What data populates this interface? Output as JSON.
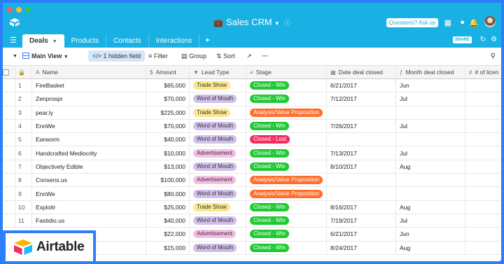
{
  "app": {
    "base_title": "Sales CRM",
    "help_button": "Questions? Ask us",
    "share_label": "SHARE"
  },
  "tabs": [
    {
      "label": "Deals",
      "active": true
    },
    {
      "label": "Products",
      "active": false
    },
    {
      "label": "Contacts",
      "active": false
    },
    {
      "label": "Interactions",
      "active": false
    }
  ],
  "toolbar": {
    "view_name": "Main View",
    "hidden_field": "1 hidden field",
    "filter": "Filter",
    "group": "Group",
    "sort": "Sort",
    "more": "···"
  },
  "columns": {
    "name": "Name",
    "amount": "Amount",
    "lead_type": "Lead Type",
    "stage": "Stage",
    "date_closed": "Date deal closed",
    "month_closed": "Month deal closed",
    "licenses": "# of licen"
  },
  "rows": [
    {
      "num": "1",
      "name": "FireBasket",
      "amount": "$65,000",
      "lead": "Trade Show",
      "lead_kind": "ts",
      "stage": "Closed - Win",
      "stage_kind": "win",
      "date": "6/21/2017",
      "month": "Jun"
    },
    {
      "num": "2",
      "name": "Zenprospr",
      "amount": "$70,000",
      "lead": "Word of Mouth",
      "lead_kind": "wom",
      "stage": "Closed - Win",
      "stage_kind": "win",
      "date": "7/12/2017",
      "month": "Jul"
    },
    {
      "num": "3",
      "name": "pear.ly",
      "amount": "$225,000",
      "lead": "Trade Show",
      "lead_kind": "ts",
      "stage": "Analysis/Value Proposition",
      "stage_kind": "avp",
      "date": "",
      "month": ""
    },
    {
      "num": "4",
      "name": "EnnWe",
      "amount": "$70,000",
      "lead": "Word of Mouth",
      "lead_kind": "wom",
      "stage": "Closed - Win",
      "stage_kind": "win",
      "date": "7/26/2017",
      "month": "Jul"
    },
    {
      "num": "5",
      "name": "Earworm",
      "amount": "$40,000",
      "lead": "Word of Mouth",
      "lead_kind": "wom",
      "stage": "Closed - Lost",
      "stage_kind": "lost",
      "date": "",
      "month": ""
    },
    {
      "num": "6",
      "name": "Handcrafted Mediocrity",
      "amount": "$10,000",
      "lead": "Advertisement",
      "lead_kind": "ad",
      "stage": "Closed - Win",
      "stage_kind": "win",
      "date": "7/13/2017",
      "month": "Jul"
    },
    {
      "num": "7",
      "name": "Objectively Edible",
      "amount": "$13,000",
      "lead": "Word of Mouth",
      "lead_kind": "wom",
      "stage": "Closed - Win",
      "stage_kind": "win",
      "date": "8/10/2017",
      "month": "Aug"
    },
    {
      "num": "8",
      "name": "Consens.us",
      "amount": "$100,000",
      "lead": "Advertisement",
      "lead_kind": "ad",
      "stage": "Analysis/Value Proposition",
      "stage_kind": "avp",
      "date": "",
      "month": ""
    },
    {
      "num": "9",
      "name": "EnnWe",
      "amount": "$80,000",
      "lead": "Word of Mouth",
      "lead_kind": "wom",
      "stage": "Analysis/Value Proposition",
      "stage_kind": "avp",
      "date": "",
      "month": ""
    },
    {
      "num": "10",
      "name": "Exploitr",
      "amount": "$25,000",
      "lead": "Trade Show",
      "lead_kind": "ts",
      "stage": "Closed - Win",
      "stage_kind": "win",
      "date": "8/16/2017",
      "month": "Aug"
    },
    {
      "num": "11",
      "name": "Fastidio.us",
      "amount": "$40,000",
      "lead": "Word of Mouth",
      "lead_kind": "wom",
      "stage": "Closed - Win",
      "stage_kind": "win",
      "date": "7/19/2017",
      "month": "Jul"
    },
    {
      "num": "",
      "name": "",
      "amount": "$22,000",
      "lead": "Advertisement",
      "lead_kind": "ad",
      "stage": "Closed - Win",
      "stage_kind": "win",
      "date": "6/21/2017",
      "month": "Jun"
    },
    {
      "num": "",
      "name": "",
      "amount": "$15,000",
      "lead": "Word of Mouth",
      "lead_kind": "wom",
      "stage": "Closed - Win",
      "stage_kind": "win",
      "date": "8/24/2017",
      "month": "Aug"
    }
  ],
  "badge": {
    "label": "Airtable"
  },
  "colors": {
    "header_blue": "#19b1e3",
    "frame_blue": "#2d7ff9",
    "win_green": "#20c933",
    "lost_red": "#f82b60",
    "avp_orange": "#ff6f2c"
  }
}
